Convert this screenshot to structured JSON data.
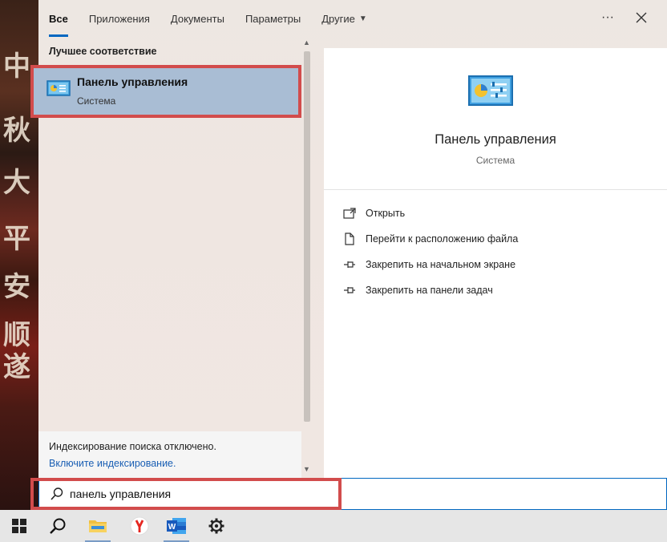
{
  "tabs": [
    {
      "label": "Все",
      "active": true
    },
    {
      "label": "Приложения",
      "active": false
    },
    {
      "label": "Документы",
      "active": false
    },
    {
      "label": "Параметры",
      "active": false
    },
    {
      "label": "Другие",
      "active": false
    }
  ],
  "window_controls": {
    "more_icon": "ellipsis-icon",
    "close_icon": "close-icon"
  },
  "best_match": {
    "section_title": "Лучшее соответствие",
    "title": "Панель управления",
    "subtitle": "Система"
  },
  "details": {
    "title": "Панель управления",
    "subtitle": "Система",
    "actions": [
      {
        "label": "Открыть",
        "icon": "open-icon"
      },
      {
        "label": "Перейти к расположению файла",
        "icon": "file-location-icon"
      },
      {
        "label": "Закрепить на начальном экране",
        "icon": "pin-icon"
      },
      {
        "label": "Закрепить на панели задач",
        "icon": "pin-icon"
      }
    ]
  },
  "indexing": {
    "message": "Индексирование поиска отключено.",
    "link": "Включите индексирование."
  },
  "search": {
    "value": "панель управления"
  },
  "taskbar": {
    "items": [
      "start-icon",
      "search-icon",
      "file-explorer-icon",
      "yandex-browser-icon",
      "word-icon",
      "settings-icon"
    ]
  },
  "colors": {
    "accent": "#0067c0",
    "highlight_border": "#d24c4c",
    "selected_bg": "#a9bdd4"
  }
}
